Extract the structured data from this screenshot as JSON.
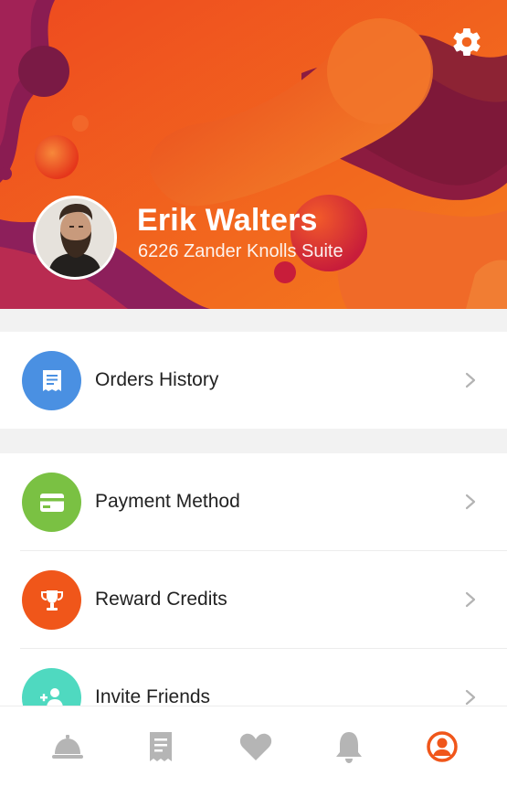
{
  "profile": {
    "name": "Erik Walters",
    "address": "6226 Zander Knolls Suite"
  },
  "menu": {
    "orders": {
      "label": "Orders History",
      "icon": "receipt-icon",
      "color": "#4a90e2"
    },
    "payment": {
      "label": "Payment Method",
      "icon": "credit-card-icon",
      "color": "#7ac143"
    },
    "rewards": {
      "label": "Reward Credits",
      "icon": "trophy-icon",
      "color": "#f0561a"
    },
    "invite": {
      "label": "Invite Friends",
      "icon": "add-user-icon",
      "color": "#4fd9c0"
    }
  },
  "tabs": [
    {
      "icon": "service-bell-icon",
      "active": false
    },
    {
      "icon": "receipt-icon",
      "active": false
    },
    {
      "icon": "heart-icon",
      "active": false
    },
    {
      "icon": "bell-icon",
      "active": false
    },
    {
      "icon": "profile-icon",
      "active": true
    }
  ],
  "colors": {
    "accent": "#f0561a",
    "tab_inactive": "#b5b5b5",
    "chevron": "#b3b3b3"
  }
}
